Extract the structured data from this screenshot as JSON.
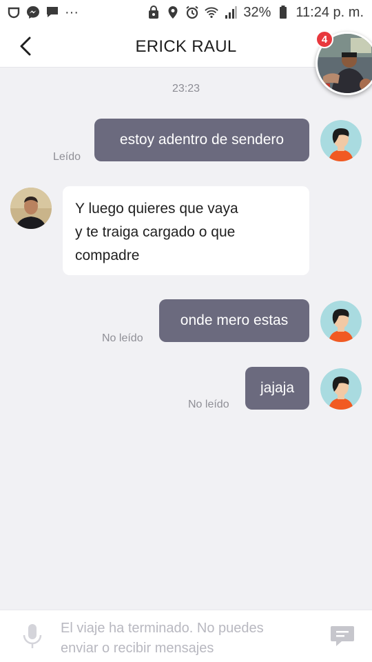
{
  "status_bar": {
    "battery": "32%",
    "time": "11:24 p. m.",
    "more_dots": "···"
  },
  "header": {
    "title": "ERICK RAUL",
    "floating_badge_count": "4"
  },
  "chat": {
    "timestamp": "23:23",
    "messages": [
      {
        "side": "outgoing",
        "text": "estoy adentro de sendero",
        "status": "Leído"
      },
      {
        "side": "incoming",
        "lines": [
          "Y luego quieres que vaya",
          "y te traiga cargado o que",
          "compadre"
        ]
      },
      {
        "side": "outgoing",
        "text": "onde mero estas",
        "status": "No leído"
      },
      {
        "side": "outgoing",
        "text": "jajaja",
        "status": "No leído"
      }
    ]
  },
  "input_bar": {
    "line1": "El viaje ha terminado. No puedes",
    "line2": "enviar o recibir mensajes"
  },
  "colors": {
    "outgoing_bubble": "#6b6a7e",
    "incoming_bubble": "#ffffff",
    "background": "#f1f1f4",
    "badge": "#e8383d"
  }
}
